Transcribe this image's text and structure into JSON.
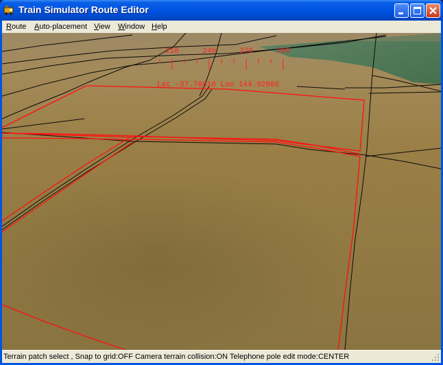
{
  "window": {
    "title": "Train Simulator Route Editor"
  },
  "titlebar_buttons": [
    "minimize",
    "maximize",
    "close"
  ],
  "menu": [
    {
      "label": "Route"
    },
    {
      "label": "Auto-placement"
    },
    {
      "label": "View"
    },
    {
      "label": "Window"
    },
    {
      "label": "Help"
    }
  ],
  "compass": {
    "ticks": [
      "210",
      "240",
      "270",
      "300"
    ],
    "coordinates": "Lat -37.78610 Lon 144.92886",
    "color": "#ff2020"
  },
  "status": {
    "text": "Terrain patch select , Snap to grid:OFF Camera terrain collision:ON Telephone pole edit mode:CENTER"
  },
  "colors": {
    "terrain": "#917a44",
    "selection": "#ff0000",
    "grass": "#4f7a56",
    "titlebar": "#0054e3"
  },
  "icons": [
    "train-app-icon",
    "minimize-icon",
    "maximize-icon",
    "close-icon",
    "size-grip-icon"
  ]
}
